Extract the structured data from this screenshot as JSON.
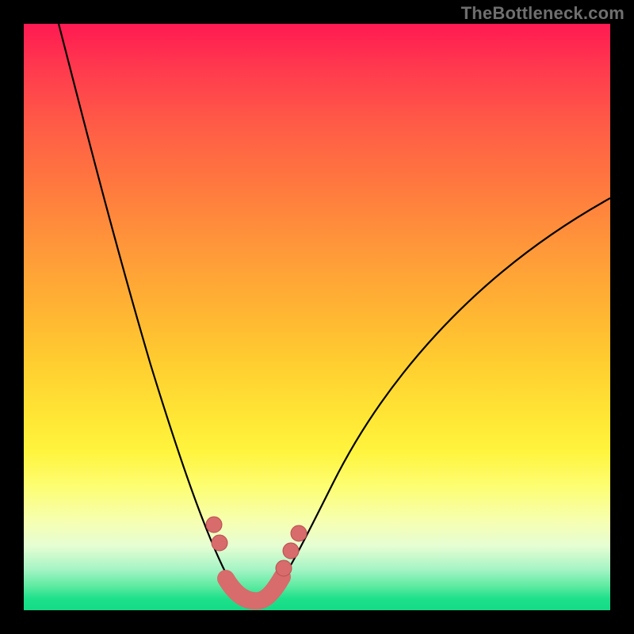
{
  "watermark": "TheBottleneck.com",
  "chart_data": {
    "type": "line",
    "title": "",
    "xlabel": "",
    "ylabel": "",
    "xlim": [
      0,
      100
    ],
    "ylim": [
      0,
      100
    ],
    "grid": false,
    "legend": false,
    "series": [
      {
        "name": "bottleneck-curve",
        "x": [
          6,
          10,
          14,
          18,
          22,
          26,
          30,
          33,
          35,
          37,
          38.5,
          40,
          42,
          45,
          50,
          56,
          64,
          74,
          86,
          100
        ],
        "y": [
          100,
          88,
          75,
          62,
          49,
          36,
          23,
          14,
          8,
          4,
          2,
          2,
          4,
          8,
          14,
          22,
          32,
          43,
          54,
          65
        ]
      }
    ],
    "markers": {
      "name": "highlight-points",
      "x": [
        32.5,
        33.5,
        43.5,
        45,
        46.5
      ],
      "y": [
        15,
        12,
        6,
        9,
        12
      ]
    },
    "bottom_band": {
      "name": "valley-segment",
      "x": [
        35,
        36.5,
        38,
        39.5,
        41,
        42.5
      ],
      "y": [
        6,
        3,
        2,
        2,
        3,
        5
      ]
    }
  }
}
